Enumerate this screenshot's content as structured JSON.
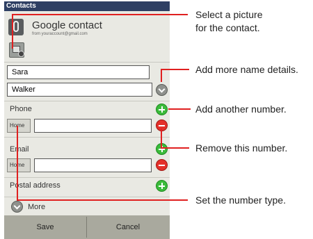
{
  "app": {
    "title": "Contacts"
  },
  "account": {
    "name": "Google contact",
    "from": "from youraccount@gmail.com"
  },
  "name_fields": {
    "first": "Sara",
    "last": "Walker"
  },
  "phone": {
    "label": "Phone",
    "type_label": "Home",
    "value": ""
  },
  "email": {
    "label": "Email",
    "type_label": "Home",
    "value": ""
  },
  "postal": {
    "label": "Postal address"
  },
  "more": {
    "label": "More"
  },
  "buttons": {
    "save": "Save",
    "cancel": "Cancel"
  },
  "callouts": {
    "picture": [
      "Select a picture",
      "for the contact."
    ],
    "name_details": "Add more name details.",
    "add_number": "Add another number.",
    "remove_number": "Remove this number.",
    "number_type": "Set the number type."
  },
  "colors": {
    "callout_line": "#e02020",
    "title_bar": "#2e3f63",
    "add": "#3bbb3b",
    "remove": "#e4302a"
  },
  "icons": [
    "account-icon",
    "picture-icon",
    "expand-name-icon",
    "add-phone-icon",
    "remove-phone-icon",
    "add-email-icon",
    "remove-email-icon",
    "add-postal-icon",
    "more-icon"
  ]
}
